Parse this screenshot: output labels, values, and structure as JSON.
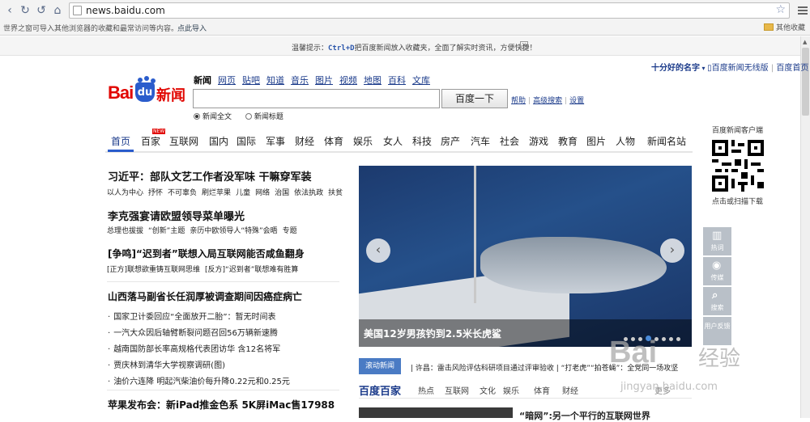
{
  "browser": {
    "url": "news.baidu.com",
    "bookmark_tip": "世界之窗可导入其他浏览器的收藏和最常访问等内容。",
    "import_link": "点此导入",
    "other_bookmarks": "其他收藏"
  },
  "tipbar": {
    "prefix": "温馨提示：",
    "shortcut": "Ctrl+D",
    "text": "把百度新闻放入收藏夹，全面了解实时资讯，方便快捷！",
    "close": "×"
  },
  "toplinks": {
    "user": "十分好的名字",
    "wireless": "百度新闻无线版",
    "home": "百度首页"
  },
  "logo": {
    "bai": "Bai",
    "du": "du",
    "news": "新闻"
  },
  "search": {
    "tabs": [
      "新闻",
      "网页",
      "贴吧",
      "知道",
      "音乐",
      "图片",
      "视频",
      "地图",
      "百科",
      "文库"
    ],
    "button": "百度一下",
    "help": "帮助",
    "advanced": "高级搜索",
    "settings": "设置",
    "radio_full": "新闻全文",
    "radio_title": "新闻标题"
  },
  "nav": {
    "items": [
      "首页",
      "百家",
      "互联网",
      "国内",
      "国际",
      "军事",
      "财经",
      "体育",
      "娱乐",
      "女人",
      "科技",
      "房产",
      "汽车",
      "社会",
      "游戏",
      "教育",
      "图片",
      "人物",
      "新闻名站"
    ],
    "new_tag": "NEW"
  },
  "qr": {
    "title": "百度新闻客户端",
    "caption": "点击或扫描下载"
  },
  "headlines": [
    {
      "title": "习近平：部队文艺工作者没军味 干嘛穿军装",
      "subs": [
        "以人为中心",
        "抒怀",
        "不可辜负",
        "刷烂苹果",
        "儿童",
        "网络",
        "治国",
        "依法执政",
        "扶贫"
      ]
    },
    {
      "title": "李克强宴请欧盟领导菜单曝光",
      "subs": [
        "总理也拔拔",
        "“创新”主题",
        "亲历中欧领导人“特殊”会晤",
        "专题"
      ]
    },
    {
      "title": "[争鸣]“迟到者”联想入局互联网能否咸鱼翻身",
      "subs": [
        "[正方]联想欲重铸互联网思维",
        "[反方]“迟到者”联想难有胜算"
      ]
    }
  ],
  "list": {
    "title": "山西落马副省长任润厚被调查期间因癌症病亡",
    "items": [
      "国家卫计委回应“全面放开二胎”：暂无时间表",
      "一汽大众因后轴臂断裂问题召回56万辆新速腾",
      "越南国防部长率高规格代表团访华 含12名将军",
      "贾庆林到清华大学视察调研(图)",
      "油价六连降 明起汽柴油价每升降0.22元和0.25元"
    ]
  },
  "apple": {
    "title": "苹果发布会：新iPad推金色系 5K屏iMac售17988"
  },
  "slide": {
    "caption": "美国12岁男孩钓到2.5米长虎鲨"
  },
  "ticker": {
    "label": "滚动新闻",
    "text": "| 许昌：雷击风险评估科研项目通过评审验收 | “打老虎”“拍苍蝇”：全党同一场攻坚"
  },
  "bd": {
    "title": "百度百家",
    "tabs": [
      "热点",
      "互联网",
      "文化",
      "娱乐",
      "体育",
      "财经"
    ],
    "more": "更多",
    "preview": "“暗网”:另一个平行的互联网世界"
  },
  "side": [
    {
      "label": "热词",
      "icon": "bar-chart-icon"
    },
    {
      "label": "传媒",
      "icon": "eye-icon"
    },
    {
      "label": "搜索",
      "icon": "search-icon"
    },
    {
      "label": "用户反馈",
      "icon": "feedback-icon"
    }
  ],
  "watermark": {
    "logo": "Bai",
    "word": "经验",
    "url": "jingyan.baidu.com"
  }
}
